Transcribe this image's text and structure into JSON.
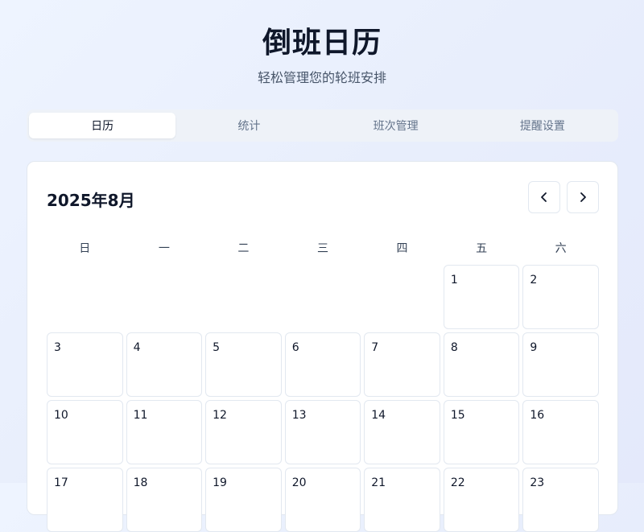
{
  "header": {
    "title": "倒班日历",
    "subtitle": "轻松管理您的轮班安排"
  },
  "tabs": [
    {
      "label": "日历",
      "active": true
    },
    {
      "label": "统计",
      "active": false
    },
    {
      "label": "班次管理",
      "active": false
    },
    {
      "label": "提醒设置",
      "active": false
    }
  ],
  "calendar": {
    "month_title": "2025年8月",
    "prev_icon": "chevron-left-icon",
    "next_icon": "chevron-right-icon",
    "weekdays": [
      "日",
      "一",
      "二",
      "三",
      "四",
      "五",
      "六"
    ],
    "leading_blank_days": 5,
    "days": [
      "1",
      "2",
      "3",
      "4",
      "5",
      "6",
      "7",
      "8",
      "9",
      "10",
      "11",
      "12",
      "13",
      "14",
      "15",
      "16",
      "17",
      "18",
      "19",
      "20",
      "21",
      "22",
      "23"
    ]
  },
  "colors": {
    "background": "#eef4ff",
    "card": "#ffffff",
    "border": "#e2e8f0",
    "text": "#0f172a",
    "muted": "#64748b"
  }
}
